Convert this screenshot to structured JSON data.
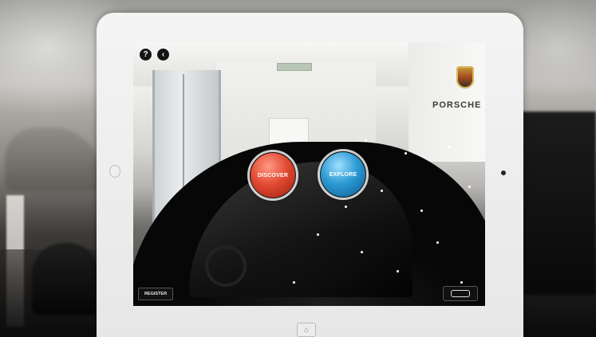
{
  "overlay": {
    "help_label": "?",
    "back_icon": "chevron-left-icon",
    "discover_label": "DISCOVER",
    "explore_label": "EXPLORE",
    "register_label": "REGISTER",
    "viewer_icon": "headset-icon"
  },
  "scene": {
    "brand_sign": "PORSCHE",
    "brand_logo": "crest-icon"
  },
  "colors": {
    "discover": "#e24a32",
    "explore": "#2c9ad4",
    "tablet_bezel": "#f1f1f1"
  }
}
